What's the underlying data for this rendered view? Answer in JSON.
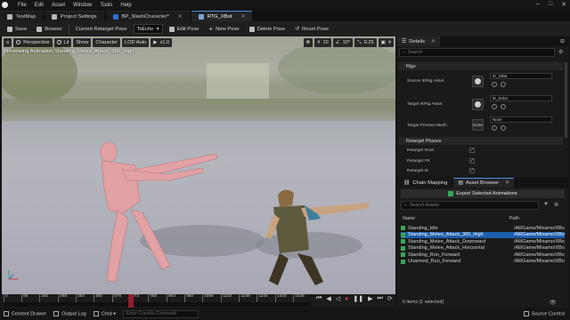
{
  "menu": {
    "items": [
      "File",
      "Edit",
      "Asset",
      "Window",
      "Tools",
      "Help"
    ]
  },
  "tabs": [
    {
      "label": "TestMap"
    },
    {
      "label": "Project Settings"
    },
    {
      "label": "BP_SlashCharacter*"
    },
    {
      "label": "RTG_XBot"
    }
  ],
  "toolbar": {
    "save": "Save",
    "browse": "Browse",
    "current_retarget_pose_label": "Current Retarget Pose",
    "current_retarget_pose_value": "ToEcho",
    "edit_pose": "Edit Pose",
    "new_pose": "New Pose",
    "delete_pose": "Delete Pose",
    "reset_pose": "Reset Pose"
  },
  "viewport": {
    "perspective": "Perspective",
    "lit": "Lit",
    "show": "Show",
    "character": "Character",
    "lod": "LOD Auto",
    "speed": "x1.0",
    "grid_snap": "10",
    "rot_snap": "10°",
    "scale_snap": "0.25",
    "cam_speed": "4",
    "preview_text": "Previewing Animation Standing_Melee_Attack_360_High"
  },
  "timeline": {
    "ticks": [
      "0",
      "96",
      "192",
      "288",
      "384",
      "480",
      "576",
      "672",
      "768",
      "864",
      "960",
      "1056",
      "1152",
      "1248",
      "1344",
      "1440",
      "1536"
    ]
  },
  "details": {
    "title": "Details",
    "search_placeholder": "Search",
    "rigs_header": "Rigs",
    "source_ik_label": "Source IKRig Asset",
    "source_ik_value": "IK_XBot",
    "target_ik_label": "Target IKRig Asset",
    "target_ik_value": "IK_Echo",
    "target_preview_label": "Target Preview Mesh",
    "target_preview_value": "None",
    "target_preview_thumb": "None",
    "retarget_phases_header": "Retarget Phases",
    "phase_root": "Retarget Root",
    "phase_fk": "Retarget FK",
    "phase_ik": "Retarget IK"
  },
  "asset_browser": {
    "tab_chain": "Chain Mapping",
    "tab_browser": "Asset Browser",
    "export_button": "Export Selected Animations",
    "search_placeholder": "Search Assets",
    "col_name": "Name",
    "col_path": "Path",
    "rows": [
      {
        "name": "Standing_Idle",
        "path": "/All/Game/Mixamo/XBo"
      },
      {
        "name": "Standing_Melee_Attack_360_High",
        "path": "/All/Game/Mixamo/XBo"
      },
      {
        "name": "Standing_Melee_Attack_Downward",
        "path": "/All/Game/Mixamo/XBo"
      },
      {
        "name": "Standing_Melee_Attack_Horizontal",
        "path": "/All/Game/Mixamo/XBo"
      },
      {
        "name": "Standing_Run_Forward",
        "path": "/All/Game/Mixamo/XBo"
      },
      {
        "name": "Unarmed_Run_Forward",
        "path": "/All/Game/Mixamo/XBo"
      }
    ],
    "count": "6 items (1 selected)"
  },
  "statusbar": {
    "content_drawer": "Content Drawer",
    "output_log": "Output Log",
    "cmd": "Cmd",
    "cmd_placeholder": "Enter Console Command",
    "source_control": "Source Control"
  },
  "colors": {
    "accent": "#4a90e2",
    "selection": "#1d5fae",
    "playhead": "#8b2030"
  }
}
